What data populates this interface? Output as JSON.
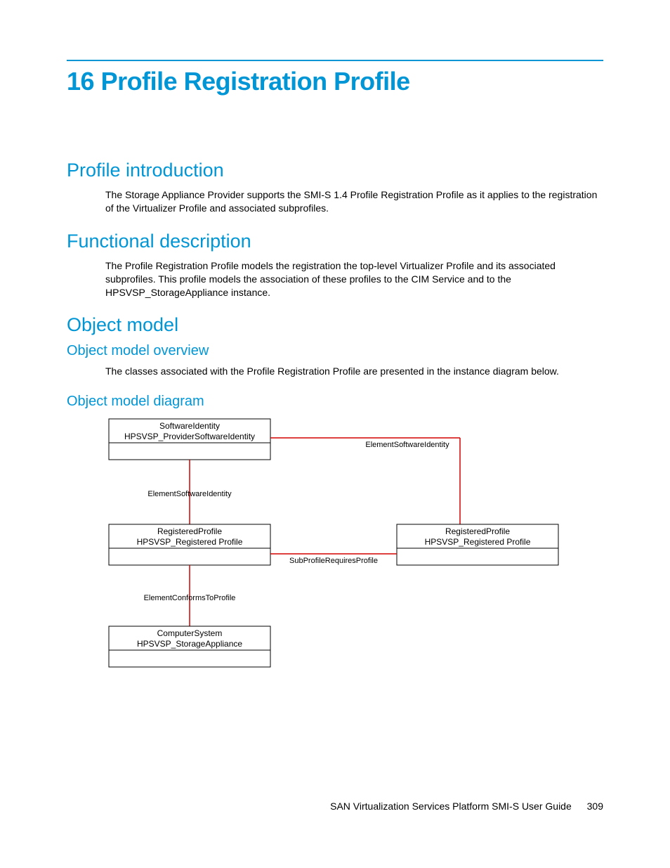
{
  "chapter": {
    "number": "16",
    "title": "Profile Registration Profile"
  },
  "sections": {
    "intro": {
      "heading": "Profile introduction",
      "body": "The Storage Appliance Provider supports the SMI-S 1.4 Profile Registration Profile as it applies to the registration of the Virtualizer Profile and associated subprofiles."
    },
    "func": {
      "heading": "Functional description",
      "body": "The Profile Registration Profile models the registration the top-level Virtualizer Profile and its associated subprofiles. This profile models the association of these profiles to the CIM Service and to the HPSVSP_StorageAppliance instance."
    },
    "model": {
      "heading": "Object model",
      "overview_heading": "Object model overview",
      "overview_body": "The classes associated with the Profile Registration Profile are presented in the instance diagram below.",
      "diagram_heading": "Object model diagram"
    }
  },
  "diagram": {
    "box1": {
      "l1": "SoftwareIdentity",
      "l2": "HPSVSP_ProviderSoftwareIdentity"
    },
    "box2": {
      "l1": "RegisteredProfile",
      "l2": "HPSVSP_Registered Profile"
    },
    "box3": {
      "l1": "RegisteredProfile",
      "l2": "HPSVSP_Registered Profile"
    },
    "box4": {
      "l1": "ComputerSystem",
      "l2": "HPSVSP_StorageAppliance"
    },
    "assoc": {
      "esi1": "ElementSoftwareIdentity",
      "esi2": "ElementSoftwareIdentity",
      "sprp": "SubProfileRequiresProfile",
      "ectp": "ElementConformsToProfile"
    }
  },
  "footer": {
    "title": "SAN Virtualization Services Platform SMI-S User Guide",
    "page": "309"
  }
}
